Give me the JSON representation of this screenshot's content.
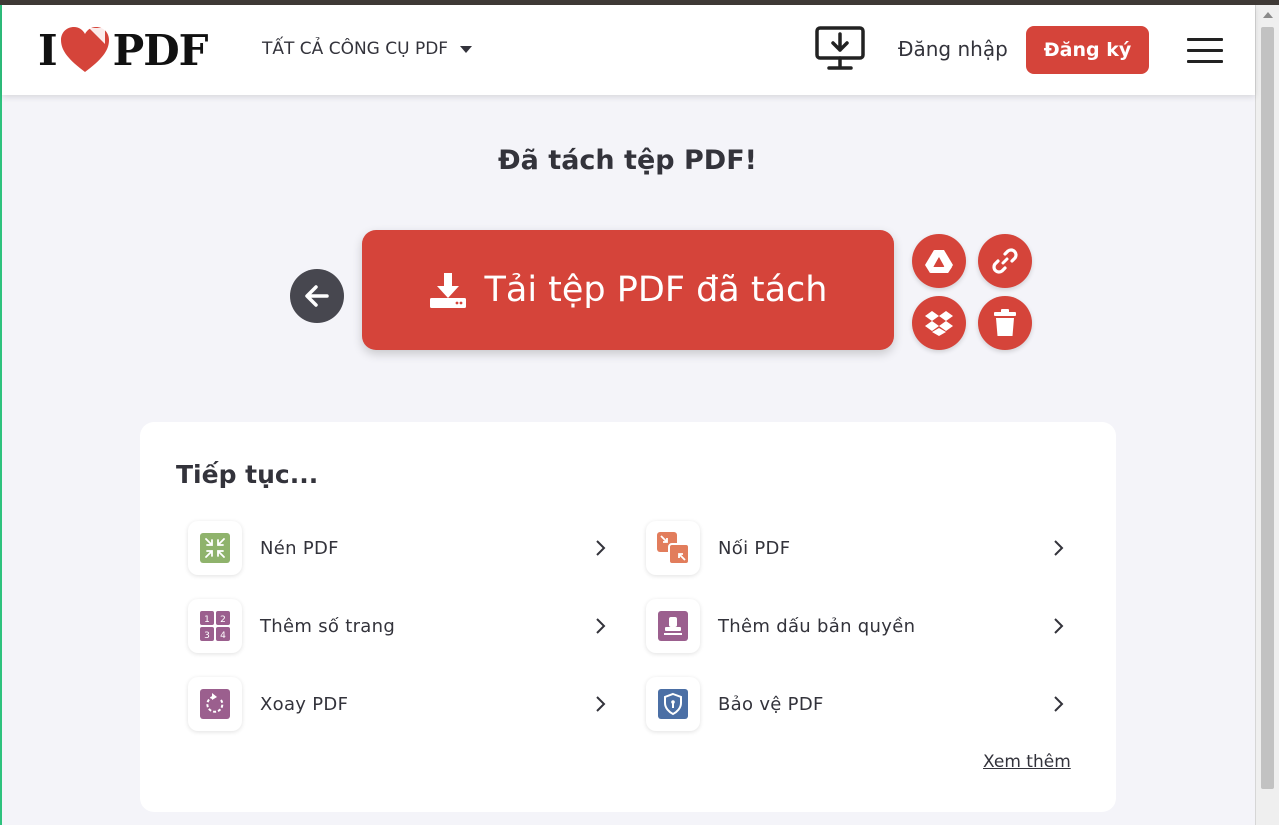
{
  "header": {
    "logo": {
      "left": "I",
      "right": "PDF"
    },
    "tools_menu_label": "TẤT CẢ CÔNG CỤ PDF",
    "login_label": "Đăng nhập",
    "signup_label": "Đăng ký"
  },
  "main": {
    "title": "Đã tách tệp PDF!",
    "download_label": "Tải tệp PDF đã tách"
  },
  "continue": {
    "title": "Tiếp tục...",
    "items": [
      {
        "label": "Nén PDF",
        "icon": "compress-icon",
        "color": "#8fb36c"
      },
      {
        "label": "Nối PDF",
        "icon": "merge-icon",
        "color": "#e27d5c"
      },
      {
        "label": "Thêm số trang",
        "icon": "page-numbers-icon",
        "color": "#9b5f8e"
      },
      {
        "label": "Thêm dấu bản quyền",
        "icon": "watermark-icon",
        "color": "#9b5f8e"
      },
      {
        "label": "Xoay PDF",
        "icon": "rotate-icon",
        "color": "#9b5f8e"
      },
      {
        "label": "Bảo vệ PDF",
        "icon": "protect-icon",
        "color": "#4b6fa5"
      }
    ],
    "see_more_label": "Xem thêm"
  },
  "colors": {
    "accent": "#d5443a",
    "dark_button": "#47474f",
    "background": "#f4f4f9"
  }
}
